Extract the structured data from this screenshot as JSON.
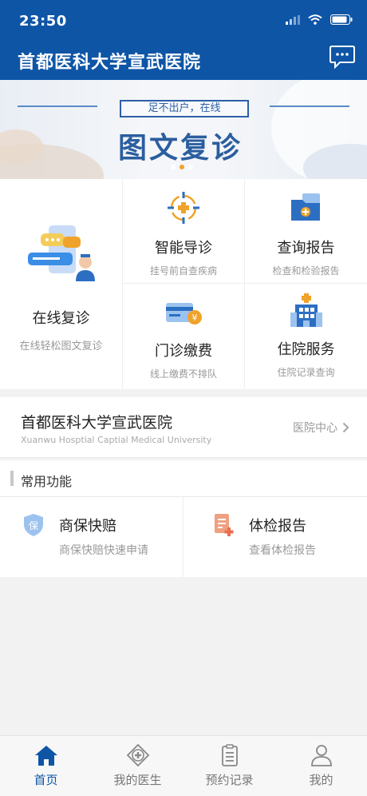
{
  "status": {
    "time": "23:50"
  },
  "header": {
    "title": "首都医科大学宣武医院",
    "message_icon": "chat-bubble-icon"
  },
  "banner": {
    "subtitle": "足不出户，在线",
    "title": "图文复诊",
    "slide_count": 3,
    "active_slide": 2
  },
  "services": {
    "online_revisit": {
      "label": "在线复诊",
      "sub": "在线轻松图文复诊"
    },
    "smart_guide": {
      "label": "智能导诊",
      "sub": "挂号前自查疾病"
    },
    "query_report": {
      "label": "查询报告",
      "sub": "检查和检验报告"
    },
    "outpatient_pay": {
      "label": "门诊缴费",
      "sub": "线上缴费不排队"
    },
    "inpatient": {
      "label": "住院服务",
      "sub": "住院记录查询"
    }
  },
  "hospital": {
    "name": "首都医科大学宣武医院",
    "name_en": "Xuanwu Hosptial Captial Medical University",
    "link": "医院中心"
  },
  "common": {
    "title": "常用功能",
    "items": [
      {
        "title": "商保快赔",
        "sub": "商保快赔快速申请",
        "icon_text": "保"
      },
      {
        "title": "体检报告",
        "sub": "查看体检报告"
      }
    ]
  },
  "tabbar": [
    {
      "label": "首页",
      "active": true
    },
    {
      "label": "我的医生",
      "active": false
    },
    {
      "label": "预约记录",
      "active": false
    },
    {
      "label": "我的",
      "active": false
    }
  ],
  "colors": {
    "primary": "#0e55a6",
    "accent": "#f0a32a"
  }
}
